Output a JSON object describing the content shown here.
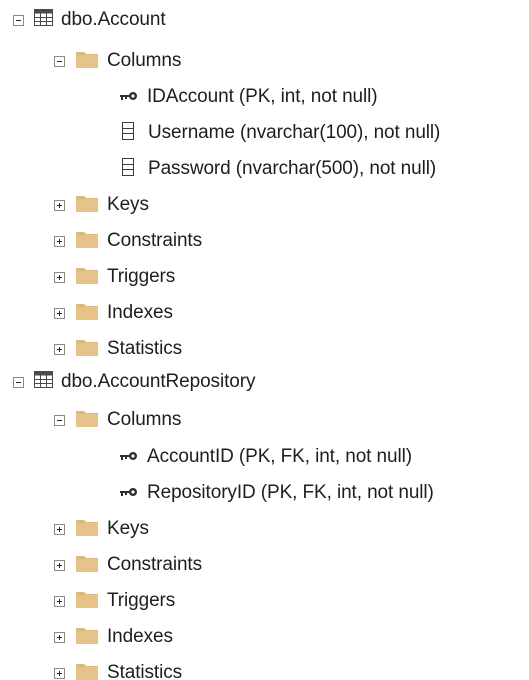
{
  "tree": {
    "tables": [
      {
        "name": "dbo.Account",
        "expanded": true,
        "columns_folder": {
          "label": "Columns",
          "expanded": true
        },
        "columns": [
          {
            "label": "IDAccount (PK, int, not null)",
            "icon": "key-icon"
          },
          {
            "label": "Username (nvarchar(100), not null)",
            "icon": "column-icon"
          },
          {
            "label": "Password (nvarchar(500), not null)",
            "icon": "column-icon"
          }
        ],
        "folders": [
          "Keys",
          "Constraints",
          "Triggers",
          "Indexes",
          "Statistics"
        ]
      },
      {
        "name": "dbo.AccountRepository",
        "expanded": true,
        "columns_folder": {
          "label": "Columns",
          "expanded": true
        },
        "columns": [
          {
            "label": "AccountID (PK, FK, int, not null)",
            "icon": "key-icon"
          },
          {
            "label": "RepositoryID (PK, FK, int, not null)",
            "icon": "key-icon"
          }
        ],
        "folders": [
          "Keys",
          "Constraints",
          "Triggers",
          "Indexes",
          "Statistics"
        ]
      }
    ]
  },
  "colors": {
    "folder": "#dcb67a",
    "folder_dark": "#c49a4e",
    "table_icon": "#4a4a4a",
    "expander_border": "#8a8a8a",
    "text": "#1e1e1e"
  }
}
